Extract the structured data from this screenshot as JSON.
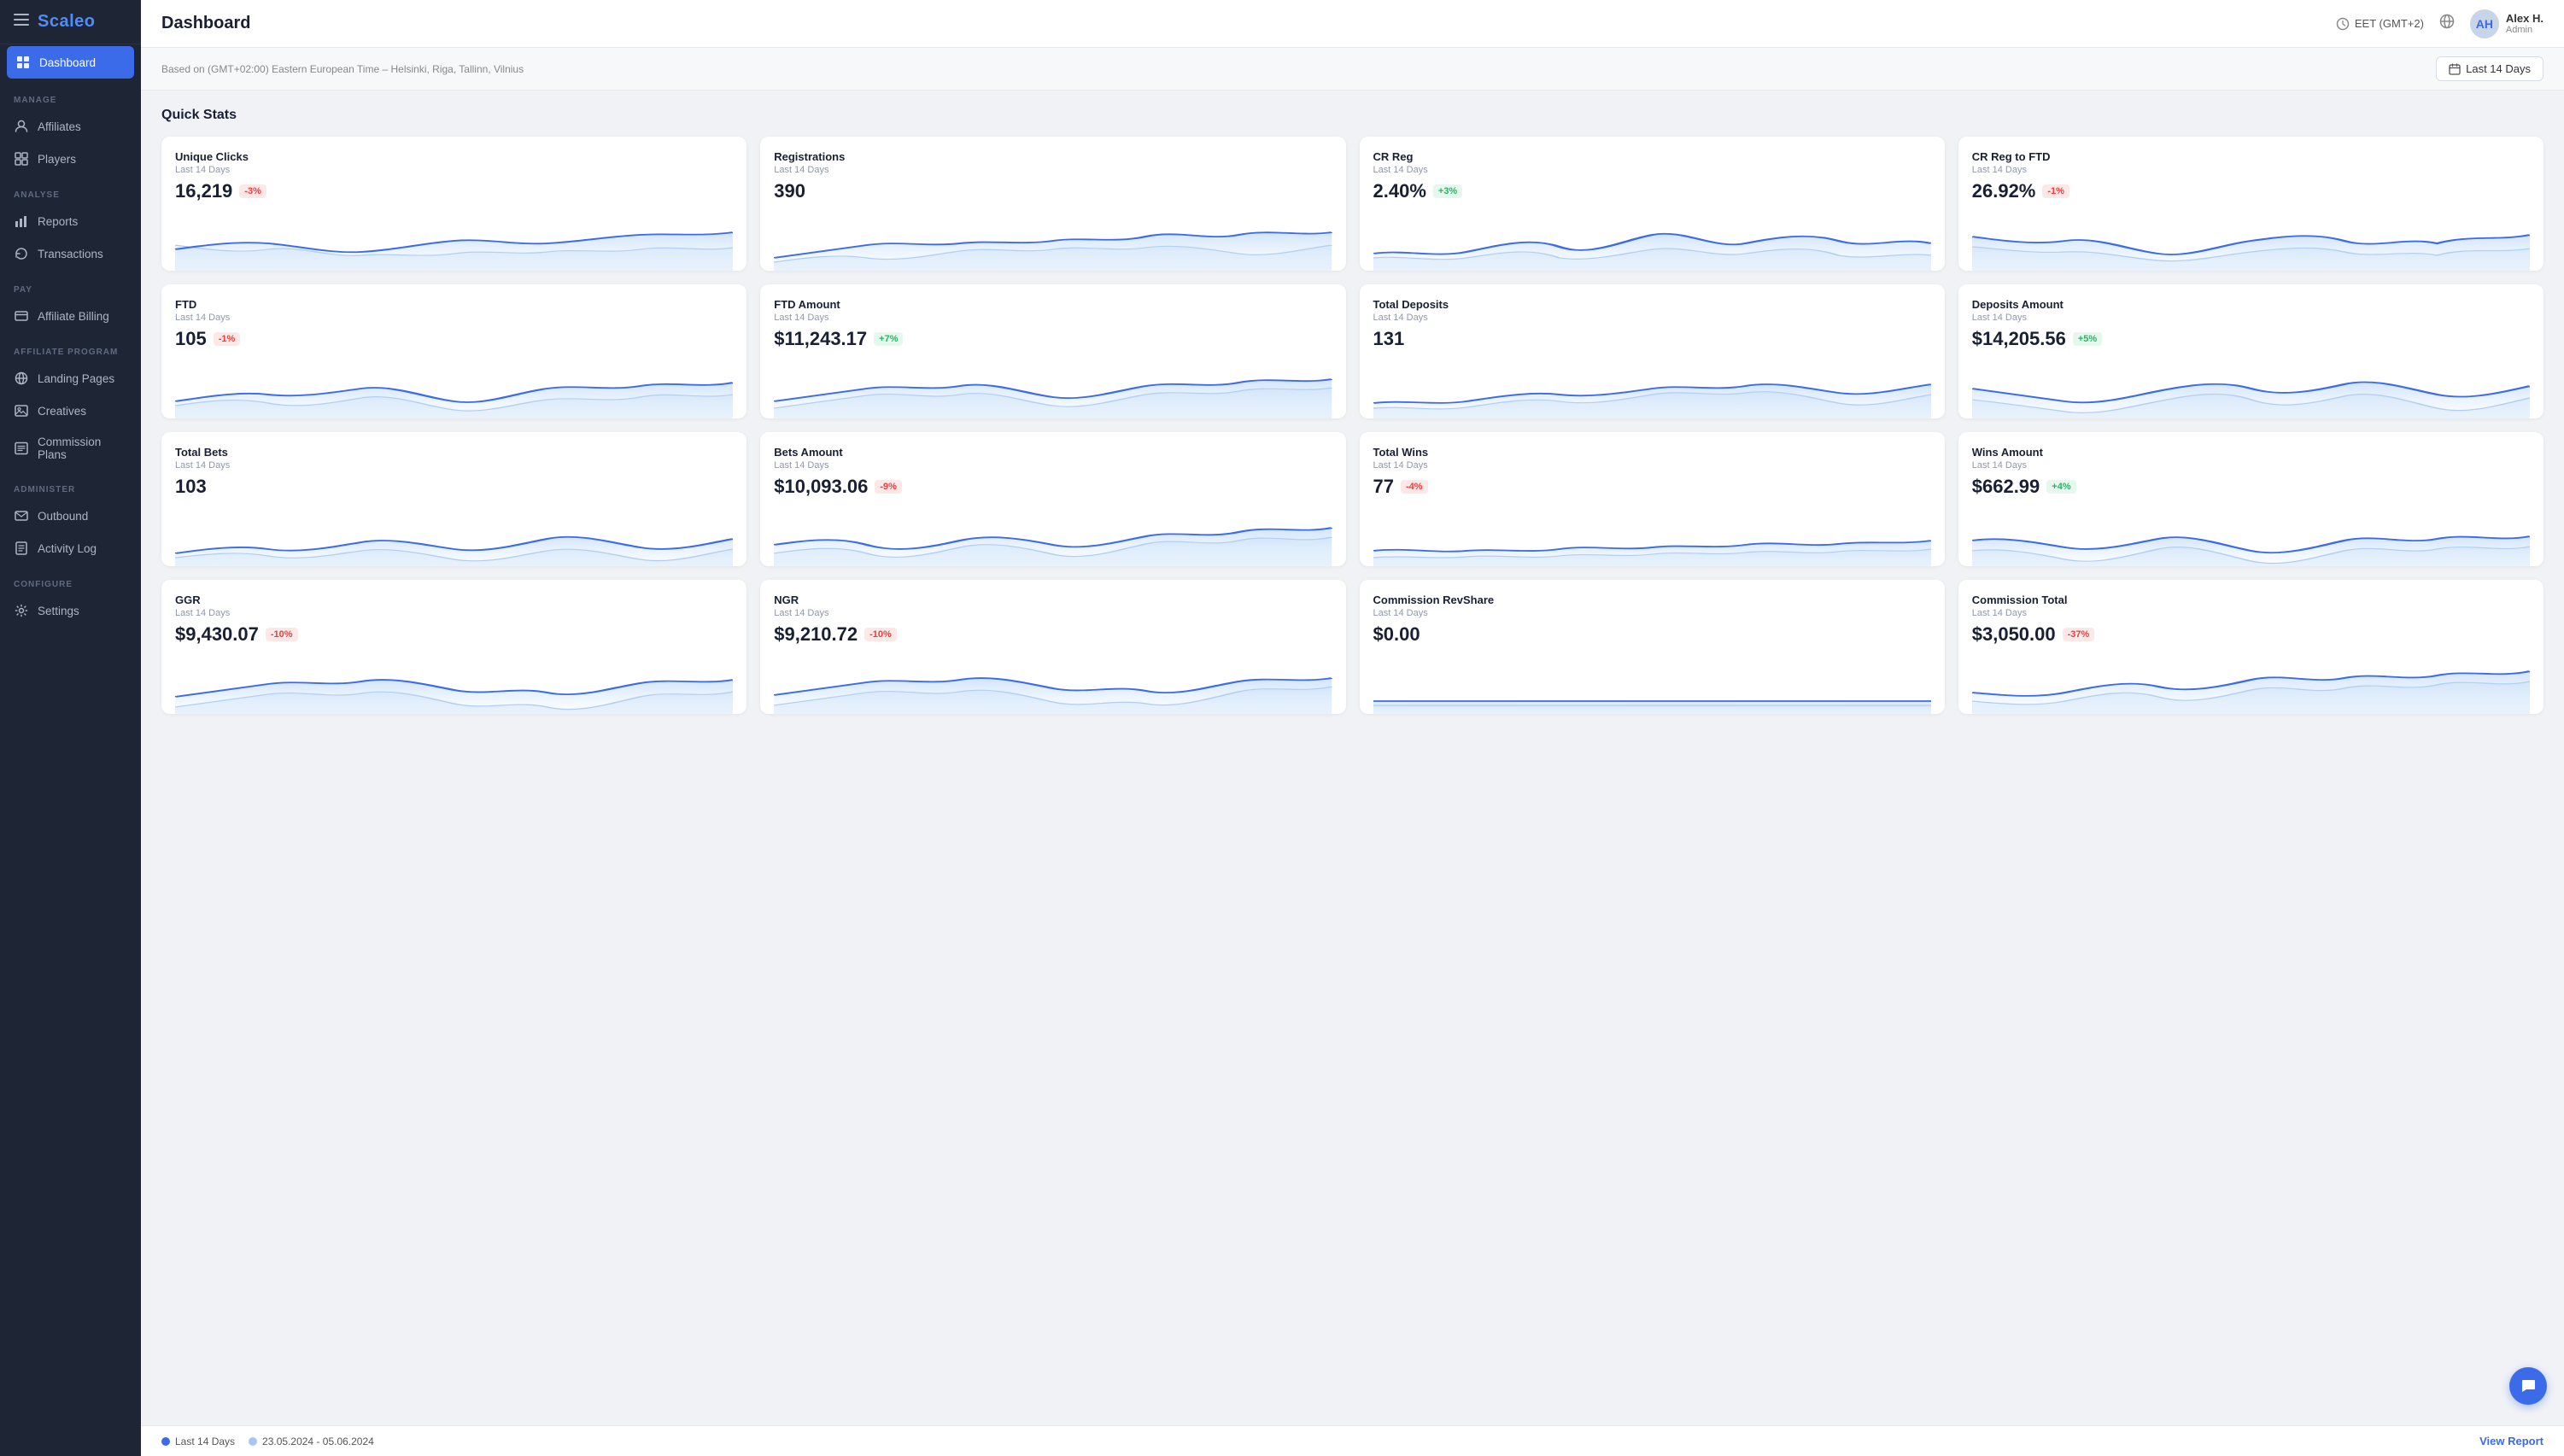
{
  "sidebar": {
    "logo": "Scaleo",
    "sections": [
      {
        "label": "MANAGE",
        "items": [
          {
            "id": "affiliates",
            "label": "Affiliates",
            "icon": "👤"
          },
          {
            "id": "players",
            "label": "Players",
            "icon": "⊞"
          }
        ]
      },
      {
        "label": "ANALYSE",
        "items": [
          {
            "id": "reports",
            "label": "Reports",
            "icon": "📊"
          },
          {
            "id": "transactions",
            "label": "Transactions",
            "icon": "🔄"
          }
        ]
      },
      {
        "label": "PAY",
        "items": [
          {
            "id": "affiliate-billing",
            "label": "Affiliate Billing",
            "icon": "💳"
          }
        ]
      },
      {
        "label": "AFFILIATE PROGRAM",
        "items": [
          {
            "id": "landing-pages",
            "label": "Landing Pages",
            "icon": "🌐"
          },
          {
            "id": "creatives",
            "label": "Creatives",
            "icon": "🖼"
          },
          {
            "id": "commission-plans",
            "label": "Commission Plans",
            "icon": "📋"
          }
        ]
      },
      {
        "label": "ADMINISTER",
        "items": [
          {
            "id": "outbound",
            "label": "Outbound",
            "icon": "📧"
          },
          {
            "id": "activity-log",
            "label": "Activity Log",
            "icon": "📝"
          }
        ]
      },
      {
        "label": "CONFIGURE",
        "items": [
          {
            "id": "settings",
            "label": "Settings",
            "icon": "⚙"
          }
        ]
      }
    ]
  },
  "topbar": {
    "title": "Dashboard",
    "timezone": "EET (GMT+2)",
    "user_name": "Alex H.",
    "user_role": "Admin"
  },
  "subbar": {
    "info": "Based on (GMT+02:00) Eastern European Time – Helsinki, Riga, Tallinn, Vilnius",
    "date_range_label": "Last 14 Days"
  },
  "quick_stats": {
    "title": "Quick Stats",
    "cards": [
      {
        "id": "unique-clicks",
        "name": "Unique Clicks",
        "period": "Last 14 Days",
        "value": "16,219",
        "badge": "-3%",
        "badge_type": "red"
      },
      {
        "id": "registrations",
        "name": "Registrations",
        "period": "Last 14 Days",
        "value": "390",
        "badge": null,
        "badge_type": null
      },
      {
        "id": "cr-reg",
        "name": "CR Reg",
        "period": "Last 14 Days",
        "value": "2.40%",
        "badge": "+3%",
        "badge_type": "green"
      },
      {
        "id": "cr-reg-ftd",
        "name": "CR Reg to FTD",
        "period": "Last 14 Days",
        "value": "26.92%",
        "badge": "-1%",
        "badge_type": "red"
      },
      {
        "id": "ftd",
        "name": "FTD",
        "period": "Last 14 Days",
        "value": "105",
        "badge": "-1%",
        "badge_type": "red"
      },
      {
        "id": "ftd-amount",
        "name": "FTD Amount",
        "period": "Last 14 Days",
        "value": "$11,243.17",
        "badge": "+7%",
        "badge_type": "green"
      },
      {
        "id": "total-deposits",
        "name": "Total Deposits",
        "period": "Last 14 Days",
        "value": "131",
        "badge": null,
        "badge_type": null
      },
      {
        "id": "deposits-amount",
        "name": "Deposits Amount",
        "period": "Last 14 Days",
        "value": "$14,205.56",
        "badge": "+5%",
        "badge_type": "green"
      },
      {
        "id": "total-bets",
        "name": "Total Bets",
        "period": "Last 14 Days",
        "value": "103",
        "badge": null,
        "badge_type": null
      },
      {
        "id": "bets-amount",
        "name": "Bets Amount",
        "period": "Last 14 Days",
        "value": "$10,093.06",
        "badge": "-9%",
        "badge_type": "red"
      },
      {
        "id": "total-wins",
        "name": "Total Wins",
        "period": "Last 14 Days",
        "value": "77",
        "badge": "-4%",
        "badge_type": "red"
      },
      {
        "id": "wins-amount",
        "name": "Wins Amount",
        "period": "Last 14 Days",
        "value": "$662.99",
        "badge": "+4%",
        "badge_type": "green"
      },
      {
        "id": "ggr",
        "name": "GGR",
        "period": "Last 14 Days",
        "value": "$9,430.07",
        "badge": "-10%",
        "badge_type": "red"
      },
      {
        "id": "ngr",
        "name": "NGR",
        "period": "Last 14 Days",
        "value": "$9,210.72",
        "badge": "-10%",
        "badge_type": "red"
      },
      {
        "id": "commission-revshare",
        "name": "Commission RevShare",
        "period": "Last 14 Days",
        "value": "$0.00",
        "badge": null,
        "badge_type": null
      },
      {
        "id": "commission-total",
        "name": "Commission Total",
        "period": "Last 14 Days",
        "value": "$3,050.00",
        "badge": "-37%",
        "badge_type": "red"
      }
    ]
  },
  "footer": {
    "legend": [
      {
        "label": "Last 14 Days",
        "color": "#3b6be8"
      },
      {
        "label": "23.05.2024 - 05.06.2024",
        "color": "#a8c6f0"
      }
    ],
    "view_report": "View Report"
  }
}
